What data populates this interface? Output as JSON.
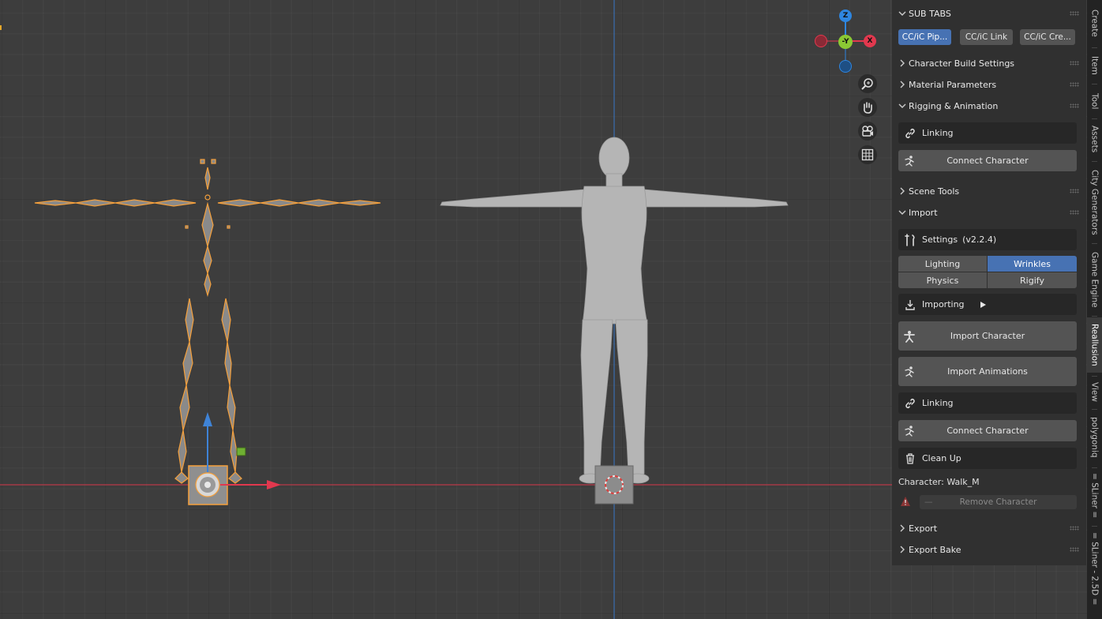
{
  "sidebar": {
    "sub_tabs_header": "SUB TABS",
    "sub_tabs": [
      "CC/iC Pip...",
      "CC/iC Link",
      "CC/iC Cre..."
    ],
    "panels": {
      "character_build_settings": "Character Build Settings",
      "material_parameters": "Material Parameters",
      "rigging_animation": "Rigging & Animation",
      "scene_tools": "Scene Tools",
      "import": "Import",
      "export": "Export",
      "export_bake": "Export Bake"
    },
    "rigging": {
      "linking": "Linking",
      "connect_character": "Connect Character"
    },
    "import": {
      "settings_label": "Settings",
      "settings_version": "(v2.2.4)",
      "options": [
        "Lighting",
        "Wrinkles",
        "Physics",
        "Rigify"
      ],
      "importing": "Importing",
      "import_character": "Import Character",
      "import_animations": "Import Animations",
      "linking": "Linking",
      "connect_character": "Connect Character",
      "clean_up": "Clean Up",
      "character_name": "Character: Walk_M",
      "remove_character": "Remove Character"
    }
  },
  "gizmo": {
    "z": "Z",
    "y": "-Y",
    "x": "X"
  },
  "side_tabs": [
    "Create",
    "Item",
    "Tool",
    "Assets",
    "City Generators",
    "Game Engine",
    "Reallusion",
    "View",
    "polygoniq",
    "= SLiner =",
    "= SLiner - 2.5D ="
  ],
  "colors": {
    "accent": "#4772b3",
    "axis_x": "#e2384e",
    "axis_y": "#8bc934",
    "axis_z": "#2e86e0",
    "selection": "#f5a03c"
  }
}
